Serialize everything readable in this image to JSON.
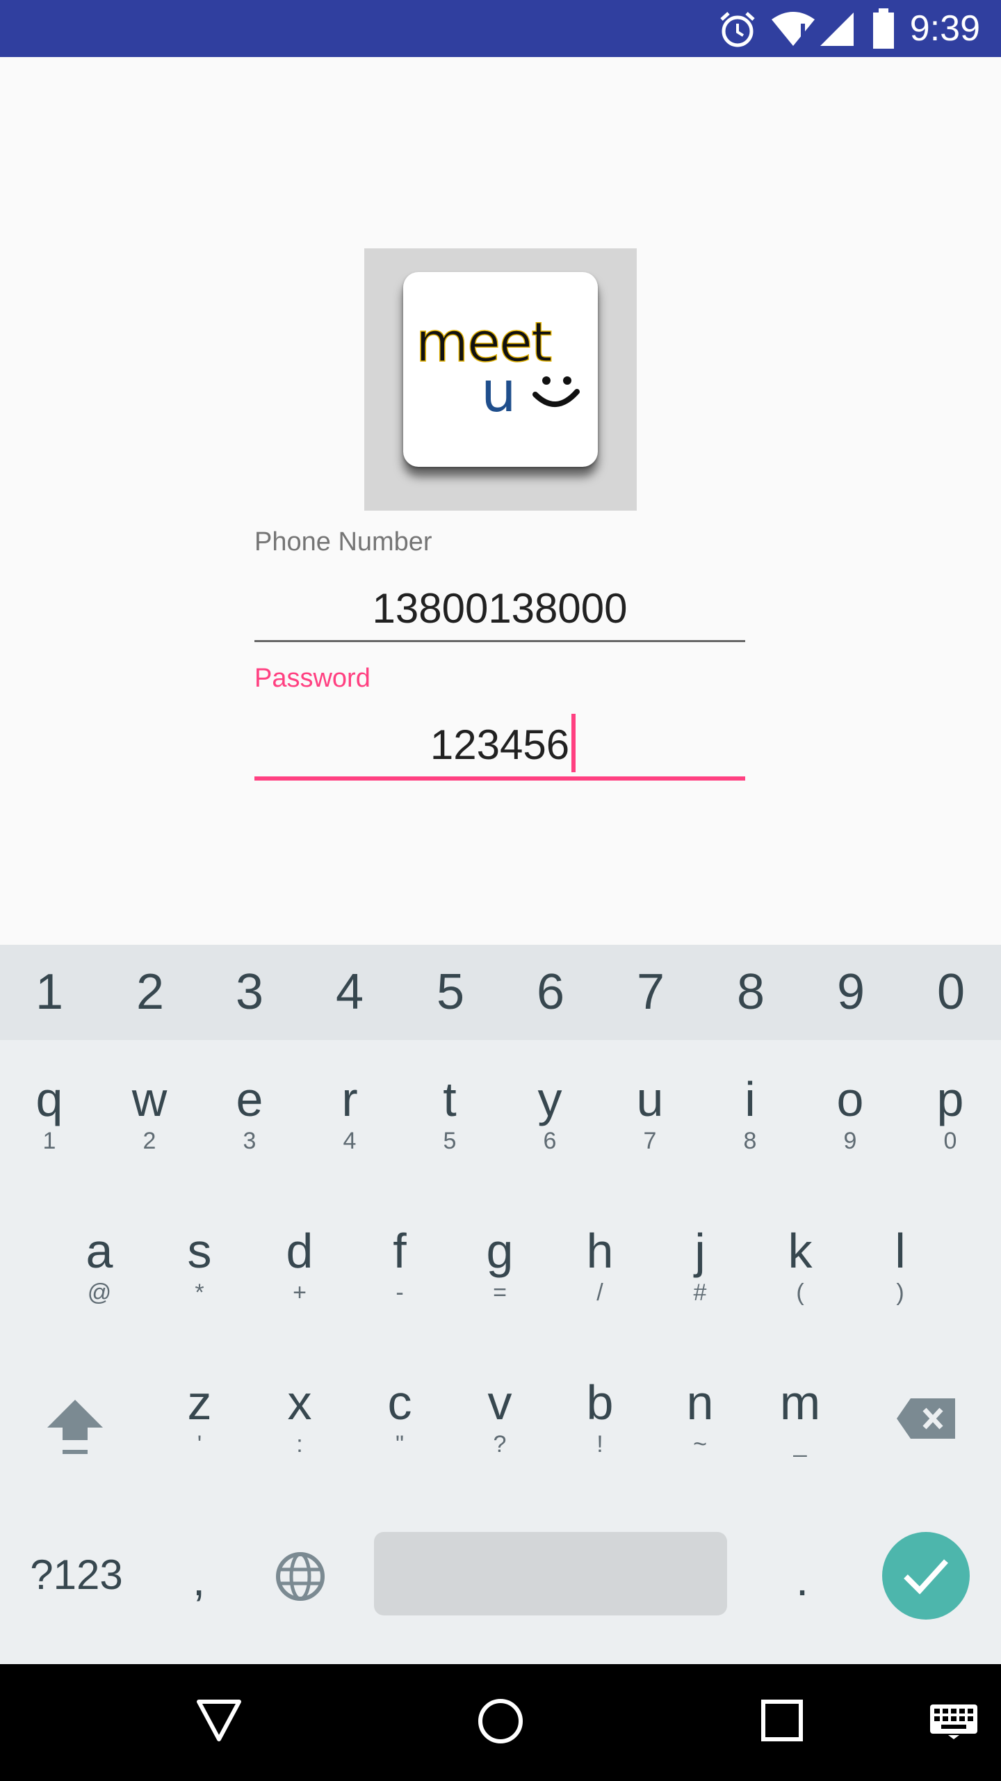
{
  "status_bar": {
    "time": "9:39",
    "icons": [
      "alarm-icon",
      "wifi-icon",
      "signal-icon",
      "battery-icon"
    ],
    "color": "#303f9f"
  },
  "logo": {
    "word1": "meet",
    "word2": "u",
    "icon": "smiley-icon"
  },
  "form": {
    "phone_label": "Phone Number",
    "phone_value": "13800138000",
    "password_label": "Password",
    "password_value": "123456",
    "accent_color": "#ff4081"
  },
  "keyboard": {
    "number_row": [
      "1",
      "2",
      "3",
      "4",
      "5",
      "6",
      "7",
      "8",
      "9",
      "0"
    ],
    "row1": [
      {
        "main": "q",
        "sub": "1"
      },
      {
        "main": "w",
        "sub": "2"
      },
      {
        "main": "e",
        "sub": "3"
      },
      {
        "main": "r",
        "sub": "4"
      },
      {
        "main": "t",
        "sub": "5"
      },
      {
        "main": "y",
        "sub": "6"
      },
      {
        "main": "u",
        "sub": "7"
      },
      {
        "main": "i",
        "sub": "8"
      },
      {
        "main": "o",
        "sub": "9"
      },
      {
        "main": "p",
        "sub": "0"
      }
    ],
    "row2": [
      {
        "main": "a",
        "sub": "@"
      },
      {
        "main": "s",
        "sub": "*"
      },
      {
        "main": "d",
        "sub": "+"
      },
      {
        "main": "f",
        "sub": "-"
      },
      {
        "main": "g",
        "sub": "="
      },
      {
        "main": "h",
        "sub": "/"
      },
      {
        "main": "j",
        "sub": "#"
      },
      {
        "main": "k",
        "sub": "("
      },
      {
        "main": "l",
        "sub": ")"
      }
    ],
    "row3": [
      {
        "main": "z",
        "sub": "'"
      },
      {
        "main": "x",
        "sub": ":"
      },
      {
        "main": "c",
        "sub": "\""
      },
      {
        "main": "v",
        "sub": "?"
      },
      {
        "main": "b",
        "sub": "!"
      },
      {
        "main": "n",
        "sub": "~"
      },
      {
        "main": "m",
        "sub": "_"
      }
    ],
    "symbols_label": "?123",
    "comma": ",",
    "period": ".",
    "enter_color": "#4db6ac"
  },
  "nav_bar": {
    "icons": [
      "back-icon",
      "home-icon",
      "recents-icon",
      "keyboard-switch-icon"
    ]
  }
}
